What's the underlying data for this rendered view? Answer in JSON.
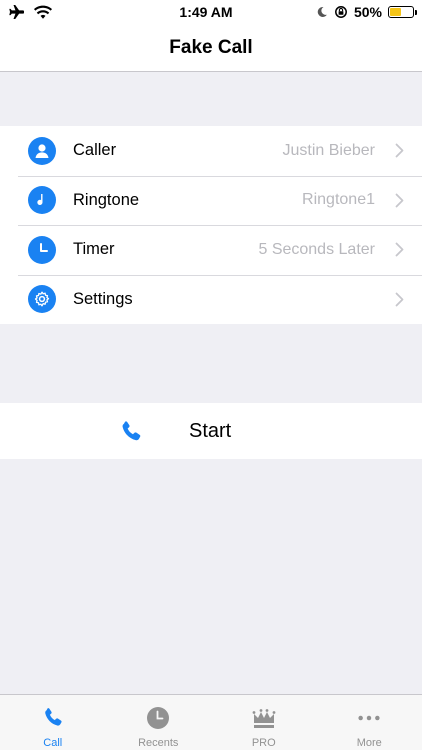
{
  "status_bar": {
    "time": "1:49 AM",
    "battery_percent": "50%",
    "battery_level": 0.5
  },
  "nav": {
    "title": "Fake Call"
  },
  "settings": [
    {
      "label": "Caller",
      "value": "Justin Bieber",
      "icon": "person-icon"
    },
    {
      "label": "Ringtone",
      "value": "Ringtone1",
      "icon": "music-note-icon"
    },
    {
      "label": "Timer",
      "value": "5 Seconds Later",
      "icon": "clock-icon"
    },
    {
      "label": "Settings",
      "value": "",
      "icon": "gear-icon"
    }
  ],
  "start": {
    "label": "Start",
    "icon": "phone-icon"
  },
  "tabs": [
    {
      "label": "Call",
      "icon": "phone-icon",
      "active": true
    },
    {
      "label": "Recents",
      "icon": "clock-icon",
      "active": false
    },
    {
      "label": "PRO",
      "icon": "crown-icon",
      "active": false
    },
    {
      "label": "More",
      "icon": "more-icon",
      "active": false
    }
  ],
  "colors": {
    "accent": "#1a82f2",
    "inactive": "#929292",
    "background": "#efeff4",
    "battery": "#f5c518"
  }
}
